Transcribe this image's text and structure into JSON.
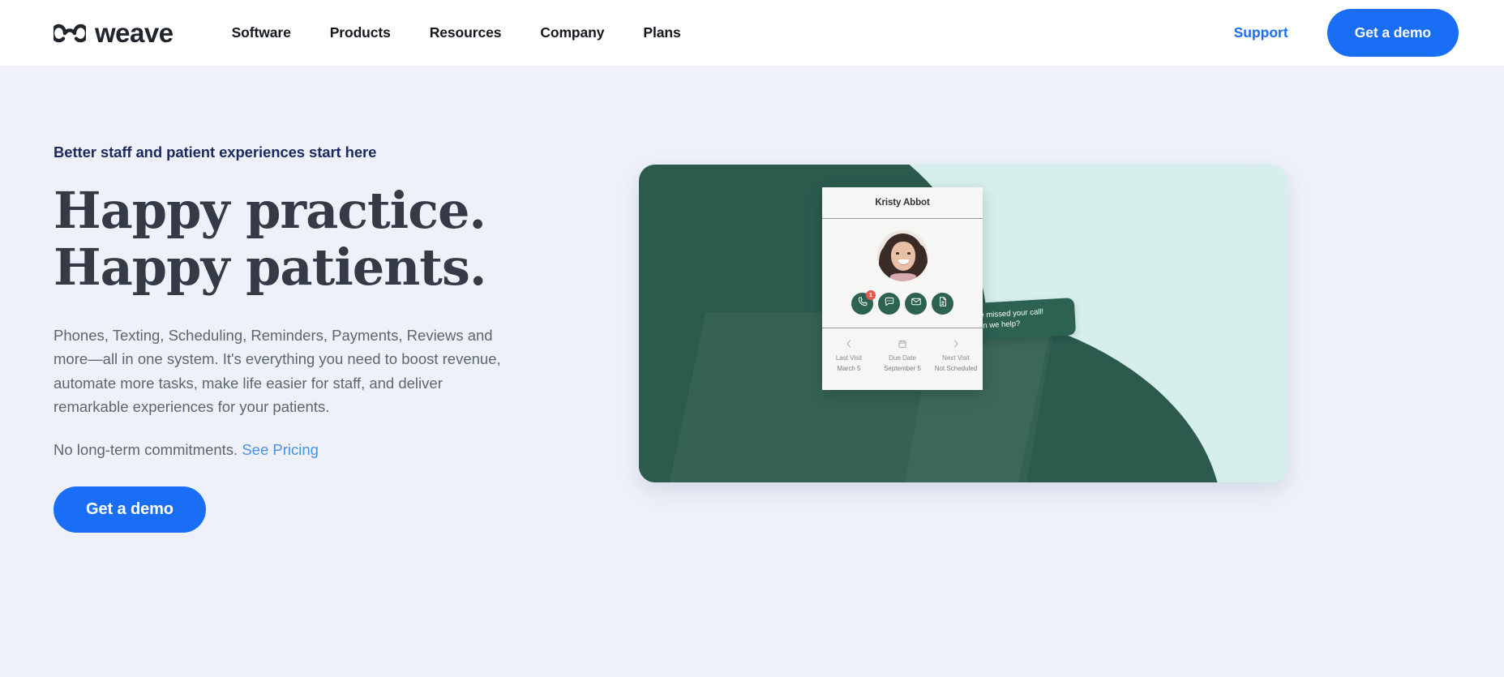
{
  "brand": {
    "name": "weave",
    "logo_icon": "weave-loops-logo",
    "accent_blue": "#1a6ef5",
    "page_bg": "#eef1fa",
    "dark_green": "#2c5b4e",
    "mint": "#d7efec",
    "headline_color": "#343b47",
    "badge_red": "#e4574f"
  },
  "nav": {
    "links": [
      {
        "label": "Software"
      },
      {
        "label": "Products"
      },
      {
        "label": "Resources"
      },
      {
        "label": "Company"
      },
      {
        "label": "Plans"
      }
    ],
    "support_label": "Support",
    "demo_label": "Get a demo"
  },
  "hero": {
    "eyebrow": "Better staff and patient experiences start here",
    "headline_line1": "Happy practice.",
    "headline_line2": "Happy patients.",
    "subcopy": "Phones, Texting, Scheduling, Reminders, Payments, Reviews and more—all in one system. It's everything you need to boost revenue, automate more tasks, make life easier for staff, and deliver remarkable experiences for your patients.",
    "pricing_text": "No long-term commitments. ",
    "pricing_link": "See Pricing",
    "cta_label": "Get a demo"
  },
  "patient_card": {
    "name": "Kristy Abbot",
    "avatar_alt": "smiling-woman-photo",
    "actions": [
      {
        "icon": "phone-icon",
        "badge": "1"
      },
      {
        "icon": "chat-bubble-icon",
        "badge": ""
      },
      {
        "icon": "envelope-icon",
        "badge": ""
      },
      {
        "icon": "document-icon",
        "badge": ""
      }
    ],
    "footer": [
      {
        "icon": "chevron-left-icon",
        "label": "Last Visit",
        "value": "March 5"
      },
      {
        "icon": "calendar-icon",
        "label": "Due Date",
        "value": "September 5"
      },
      {
        "icon": "chevron-right-icon",
        "label": "Next Visit",
        "value": "Not Scheduled"
      }
    ]
  },
  "bubble": {
    "line1": "we missed your call!",
    "line2": "can we help?"
  }
}
